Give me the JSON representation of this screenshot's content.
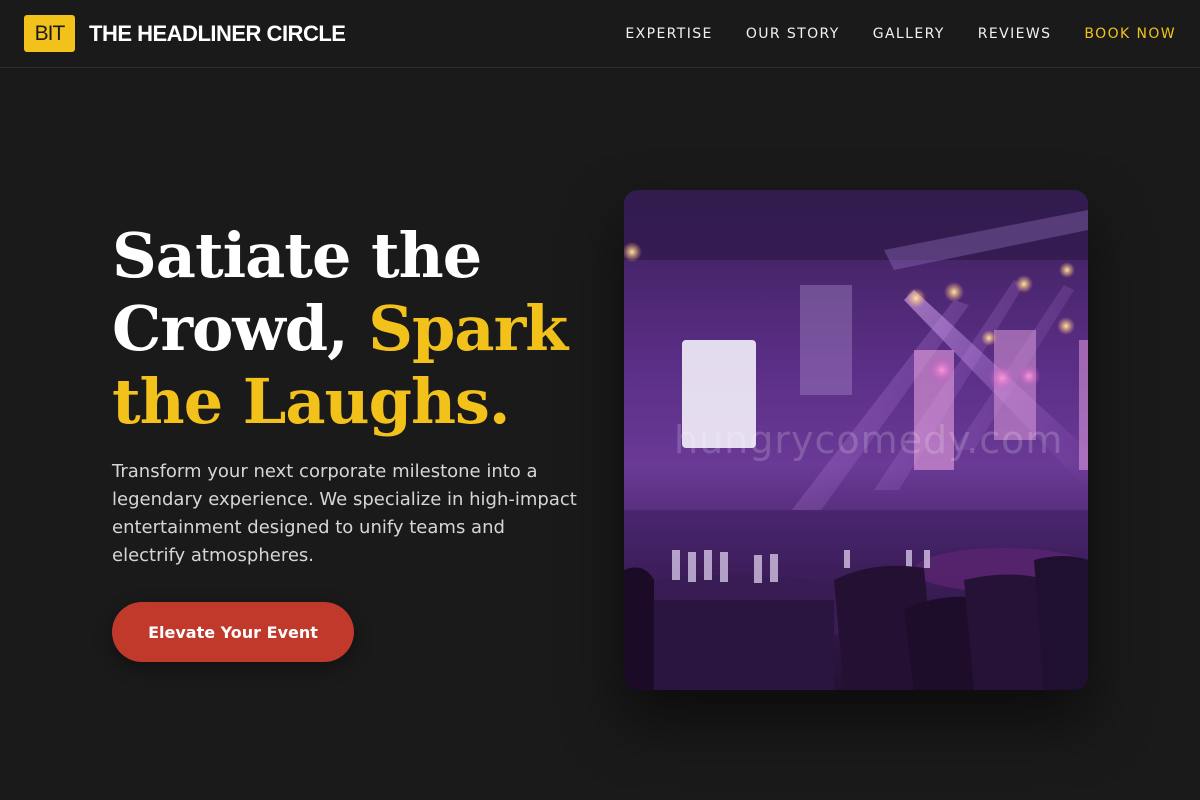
{
  "header": {
    "logo_badge": "BIT",
    "brand_name": "THE HEADLINER CIRCLE",
    "nav": [
      {
        "label": "EXPERTISE"
      },
      {
        "label": "OUR STORY"
      },
      {
        "label": "GALLERY"
      },
      {
        "label": "REVIEWS"
      },
      {
        "label": "BOOK NOW"
      }
    ]
  },
  "hero": {
    "title_line1": "Satiate the",
    "title_line2a": "Crowd, ",
    "title_line2b": "Spark",
    "title_line3": "the Laughs.",
    "description": "Transform your next corporate milestone into a legendary experience. We specialize in high-impact entertainment designed to unify teams and electrify atmospheres.",
    "cta_label": "Elevate Your Event",
    "image_watermark": "hungrycomedy.com"
  },
  "colors": {
    "background": "#1a1a1a",
    "accent_yellow": "#f2c21b",
    "cta_red": "#c0392b"
  }
}
